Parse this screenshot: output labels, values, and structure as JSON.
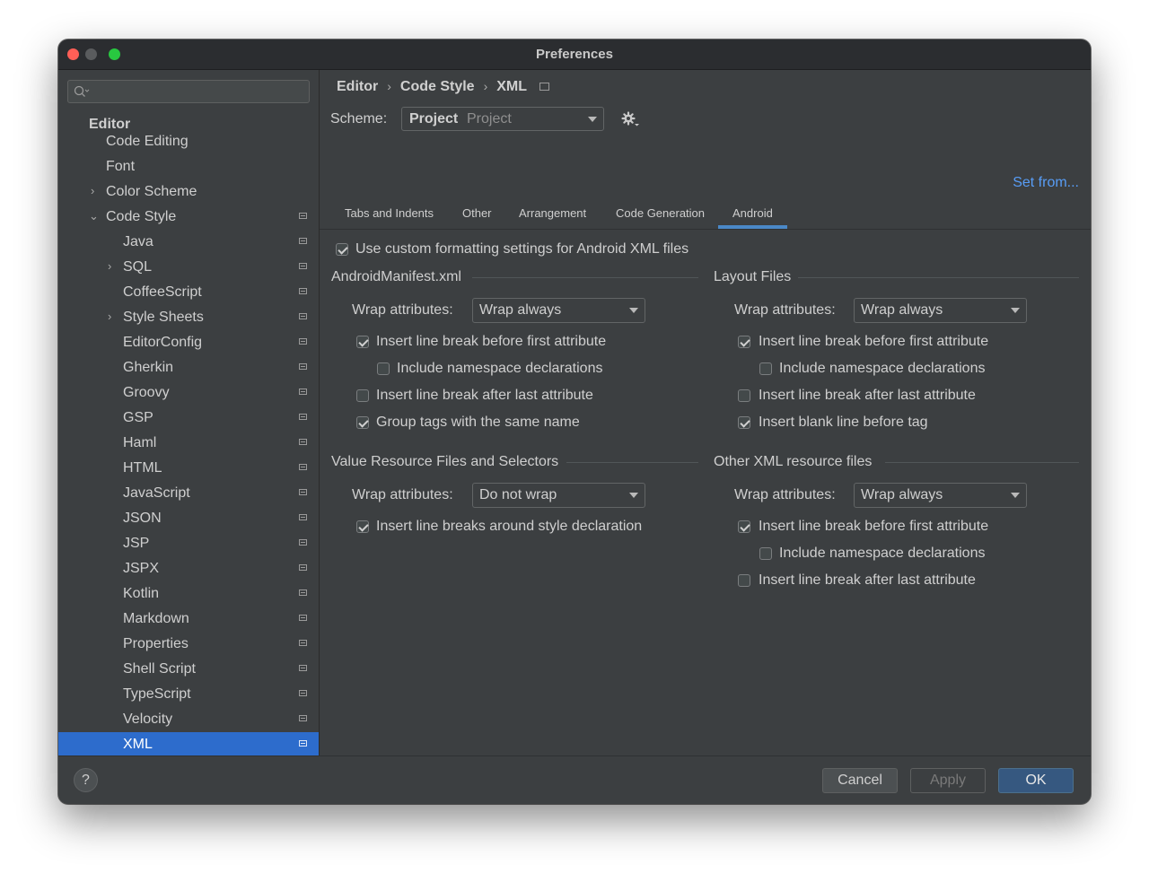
{
  "window": {
    "title": "Preferences"
  },
  "sidebar": {
    "search_placeholder": "",
    "section": "Editor",
    "items": [
      {
        "label": "Code Editing"
      },
      {
        "label": "Font"
      },
      {
        "label": "Color Scheme"
      },
      {
        "label": "Code Style"
      },
      {
        "label": "Java"
      },
      {
        "label": "SQL"
      },
      {
        "label": "CoffeeScript"
      },
      {
        "label": "Style Sheets"
      },
      {
        "label": "EditorConfig"
      },
      {
        "label": "Gherkin"
      },
      {
        "label": "Groovy"
      },
      {
        "label": "GSP"
      },
      {
        "label": "Haml"
      },
      {
        "label": "HTML"
      },
      {
        "label": "JavaScript"
      },
      {
        "label": "JSON"
      },
      {
        "label": "JSP"
      },
      {
        "label": "JSPX"
      },
      {
        "label": "Kotlin"
      },
      {
        "label": "Markdown"
      },
      {
        "label": "Properties"
      },
      {
        "label": "Shell Script"
      },
      {
        "label": "TypeScript"
      },
      {
        "label": "Velocity"
      },
      {
        "label": "XML"
      }
    ]
  },
  "breadcrumb": [
    "Editor",
    "Code Style",
    "XML"
  ],
  "scheme": {
    "label": "Scheme:",
    "name": "Project",
    "sub": "Project"
  },
  "set_from": "Set from...",
  "tabs": [
    "Tabs and Indents",
    "Other",
    "Arrangement",
    "Code Generation",
    "Android"
  ],
  "active_tab": "Android",
  "custom_formatting": {
    "label": "Use custom formatting settings for Android XML files",
    "checked": true
  },
  "sections": {
    "manifest": {
      "title": "AndroidManifest.xml",
      "wrap_label": "Wrap attributes:",
      "wrap_value": "Wrap always",
      "options": [
        {
          "label": "Insert line break before first attribute",
          "checked": true
        },
        {
          "label": "Include namespace declarations",
          "checked": false
        },
        {
          "label": "Insert line break after last attribute",
          "checked": false
        },
        {
          "label": "Group tags with the same name",
          "checked": true
        }
      ]
    },
    "layout": {
      "title": "Layout Files",
      "wrap_label": "Wrap attributes:",
      "wrap_value": "Wrap always",
      "options": [
        {
          "label": "Insert line break before first attribute",
          "checked": true
        },
        {
          "label": "Include namespace declarations",
          "checked": false
        },
        {
          "label": "Insert line break after last attribute",
          "checked": false
        },
        {
          "label": "Insert blank line before tag",
          "checked": true
        }
      ]
    },
    "values": {
      "title": "Value Resource Files and Selectors",
      "wrap_label": "Wrap attributes:",
      "wrap_value": "Do not wrap",
      "options": [
        {
          "label": "Insert line breaks around style declaration",
          "checked": true
        }
      ]
    },
    "other": {
      "title": "Other XML resource files",
      "wrap_label": "Wrap attributes:",
      "wrap_value": "Wrap always",
      "options": [
        {
          "label": "Insert line break before first attribute",
          "checked": true
        },
        {
          "label": "Include namespace declarations",
          "checked": false
        },
        {
          "label": "Insert line break after last attribute",
          "checked": false
        }
      ]
    }
  },
  "footer": {
    "help": "?",
    "cancel": "Cancel",
    "apply": "Apply",
    "ok": "OK"
  },
  "colors": {
    "accent": "#2d6ccc",
    "link": "#589df6",
    "background": "#3c3f41"
  }
}
